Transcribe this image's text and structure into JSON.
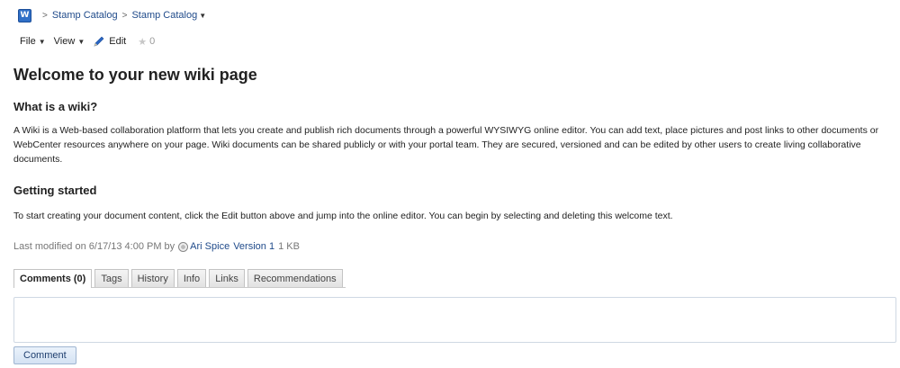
{
  "breadcrumb": {
    "icon": "wiki-icon",
    "icon_letter": "W",
    "items": [
      "Stamp Catalog",
      "Stamp Catalog"
    ],
    "separator": ">"
  },
  "menubar": {
    "file_label": "File",
    "view_label": "View",
    "edit_label": "Edit",
    "rating_count": "0"
  },
  "page": {
    "title": "Welcome to your new wiki page",
    "section1_heading": "What is a wiki?",
    "section1_text": "A Wiki is a Web-based collaboration platform that lets you create and publish rich documents through a powerful WYSIWYG online editor. You can add text, place pictures and post links to other documents or WebCenter resources anywhere on your page. Wiki documents can be shared publicly or with your portal team. They are secured, versioned and can be edited by other users to create living collaborative documents.",
    "section2_heading": "Getting started",
    "section2_text": "To start creating your document content, click the Edit button above and jump into the online editor. You can begin by selecting and deleting this welcome text."
  },
  "meta": {
    "modified_prefix": "Last modified on 6/17/13 4:00 PM by",
    "author": "Ari Spice",
    "version": "Version 1",
    "size": "1 KB"
  },
  "tabs": [
    "Comments (0)",
    "Tags",
    "History",
    "Info",
    "Links",
    "Recommendations"
  ],
  "comment": {
    "button_label": "Comment",
    "input_value": ""
  },
  "colors": {
    "link": "#1f4a8a",
    "wiki_icon": "#2f6fc7",
    "edit_pencil": "#2a66c4"
  }
}
